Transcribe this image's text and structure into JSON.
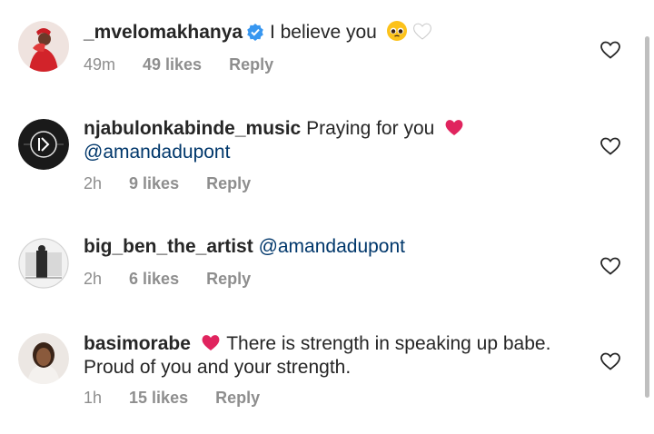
{
  "comments": [
    {
      "username": "_mvelomakhanya",
      "verified": true,
      "text": "I believe you",
      "emojis": [
        "pleading-face-emoji",
        "white-heart-emoji"
      ],
      "time": "49m",
      "likes": "49 likes",
      "reply": "Reply"
    },
    {
      "username": "njabulonkabinde_music",
      "text": "Praying for you",
      "emojis": [
        "red-heart-emoji"
      ],
      "mention": "@amandadupont",
      "time": "2h",
      "likes": "9 likes",
      "reply": "Reply"
    },
    {
      "username": "big_ben_the_artist",
      "mention": "@amandadupont",
      "time": "2h",
      "likes": "6 likes",
      "reply": "Reply"
    },
    {
      "username": "basimorabe",
      "emojis": [
        "red-heart-emoji"
      ],
      "text": "There is strength in speaking up babe. Proud of you and your strength.",
      "time": "1h",
      "likes": "15 likes",
      "reply": "Reply"
    }
  ],
  "colors": {
    "text": "#262626",
    "meta": "#8e8e8e",
    "mention": "#00376b",
    "verified": "#3897f0",
    "heart_emoji": "#e0245e"
  }
}
